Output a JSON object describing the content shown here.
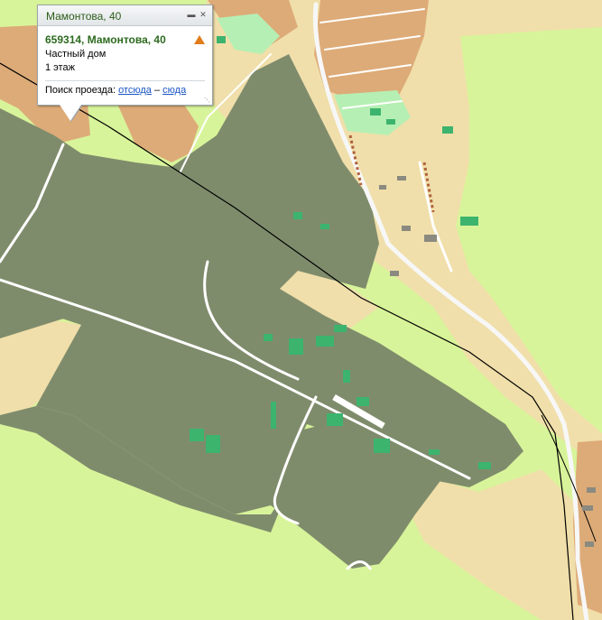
{
  "popup": {
    "title": "Мамонтова, 40",
    "address": "659314, Мамонтова, 40",
    "type": "Частный дом",
    "floors": "1 этаж",
    "route_prefix": "Поиск проезда:",
    "route_from": "отсюда",
    "route_dash": "–",
    "route_to": "сюда",
    "collapse_icon": "collapse-icon",
    "close_icon": "close-icon",
    "warning_icon": "warning-icon"
  },
  "colors": {
    "field": "#d8f49a",
    "industrial_zone": "#7f8c6c",
    "residential": "#f0dfaa",
    "private_housing": "#ddab78",
    "building": "#3cb46e",
    "park": "#b6efb3",
    "road": "#ffffff",
    "railway": "#000000",
    "accent_road": "#d39a4f"
  }
}
